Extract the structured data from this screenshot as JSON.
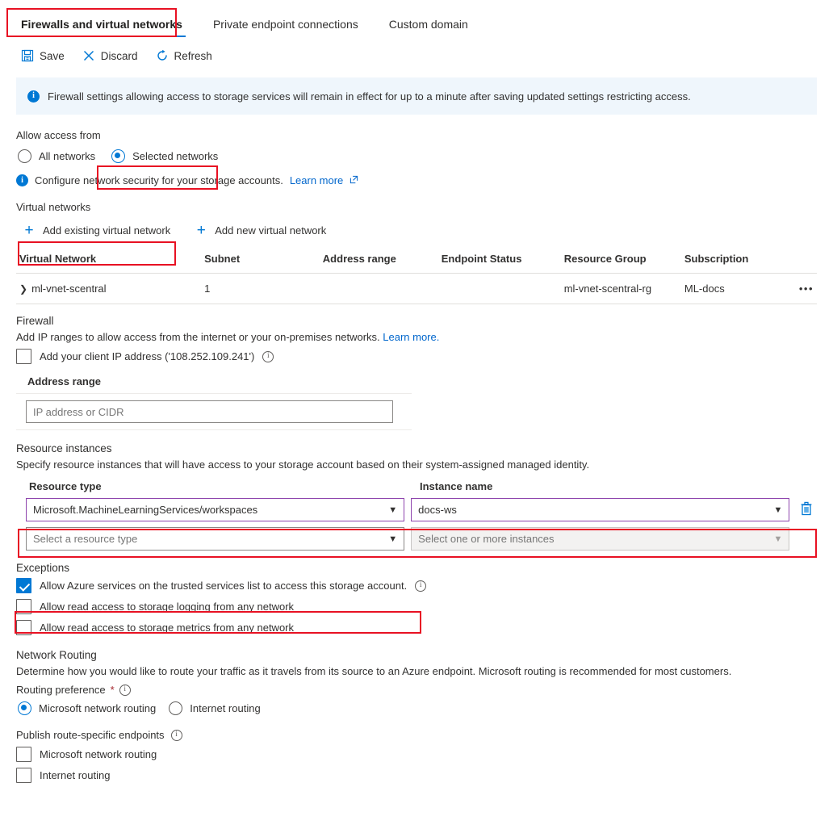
{
  "tabs": [
    {
      "label": "Firewalls and virtual networks",
      "active": true
    },
    {
      "label": "Private endpoint connections",
      "active": false
    },
    {
      "label": "Custom domain",
      "active": false
    }
  ],
  "commandbar": {
    "save_label": "Save",
    "discard_label": "Discard",
    "refresh_label": "Refresh"
  },
  "banner": {
    "icon": "info-icon",
    "text": "Firewall settings allowing access to storage services will remain in effect for up to a minute after saving updated settings restricting access."
  },
  "allow_access": {
    "label": "Allow access from",
    "options": [
      {
        "label": "All networks",
        "selected": false
      },
      {
        "label": "Selected networks",
        "selected": true
      }
    ],
    "note": "Configure network security for your storage accounts.",
    "note_link": "Learn more"
  },
  "virtual_networks": {
    "label": "Virtual networks",
    "add_existing_label": "Add existing virtual network",
    "add_new_label": "Add new virtual network",
    "columns": [
      "Virtual Network",
      "Subnet",
      "Address range",
      "Endpoint Status",
      "Resource Group",
      "Subscription"
    ],
    "rows": [
      {
        "virtual_network": "ml-vnet-scentral",
        "subnet": "1",
        "address_range": "",
        "endpoint_status": "",
        "resource_group": "ml-vnet-scentral-rg",
        "subscription": "ML-docs",
        "menu": "•••"
      }
    ]
  },
  "firewall": {
    "heading": "Firewall",
    "description": "Add IP ranges to allow access from the internet or your on-premises networks.",
    "description_link": "Learn more.",
    "client_ip_checkbox": {
      "label": "Add your client IP address ('108.252.109.241')",
      "checked": false
    },
    "address_range_label": "Address range",
    "address_range_placeholder": "IP address or CIDR",
    "address_range_value": ""
  },
  "resource_instances": {
    "heading": "Resource instances",
    "description": "Specify resource instances that will have access to your storage account based on their system-assigned managed identity.",
    "col_resource_type": "Resource type",
    "col_instance_name": "Instance name",
    "rows": [
      {
        "resource_type": "Microsoft.MachineLearningServices/workspaces",
        "instance_name": "docs-ws",
        "disabled": false,
        "delete_icon": "trash-icon"
      },
      {
        "resource_type": "Select a resource type",
        "instance_name": "Select one or more instances",
        "disabled": true,
        "delete_icon": ""
      }
    ]
  },
  "exceptions": {
    "heading": "Exceptions",
    "items": [
      {
        "label": "Allow Azure services on the trusted services list to access this storage account.",
        "checked": true,
        "info": true
      },
      {
        "label": "Allow read access to storage logging from any network",
        "checked": false,
        "info": false
      },
      {
        "label": "Allow read access to storage metrics from any network",
        "checked": false,
        "info": false
      }
    ]
  },
  "network_routing": {
    "heading": "Network Routing",
    "description": "Determine how you would like to route your traffic as it travels from its source to an Azure endpoint. Microsoft routing is recommended for most customers.",
    "routing_preference_label": "Routing preference",
    "required_mark": "*",
    "options": [
      {
        "label": "Microsoft network routing",
        "selected": true
      },
      {
        "label": "Internet routing",
        "selected": false
      }
    ],
    "publish_label": "Publish route-specific endpoints",
    "publish_options": [
      {
        "label": "Microsoft network routing",
        "checked": false
      },
      {
        "label": "Internet routing",
        "checked": false
      }
    ]
  },
  "colors": {
    "accent": "#0078d4",
    "annotation": "#e81123",
    "dropdown_focus": "#8e44ad",
    "banner_bg": "#eff6fc",
    "link": "#0066cc"
  },
  "annotations": [
    {
      "name": "highlight-active-tab"
    },
    {
      "name": "highlight-selected-networks-radio"
    },
    {
      "name": "highlight-add-existing-vnet"
    },
    {
      "name": "highlight-resource-instance-row"
    },
    {
      "name": "highlight-allow-trusted-services"
    }
  ]
}
